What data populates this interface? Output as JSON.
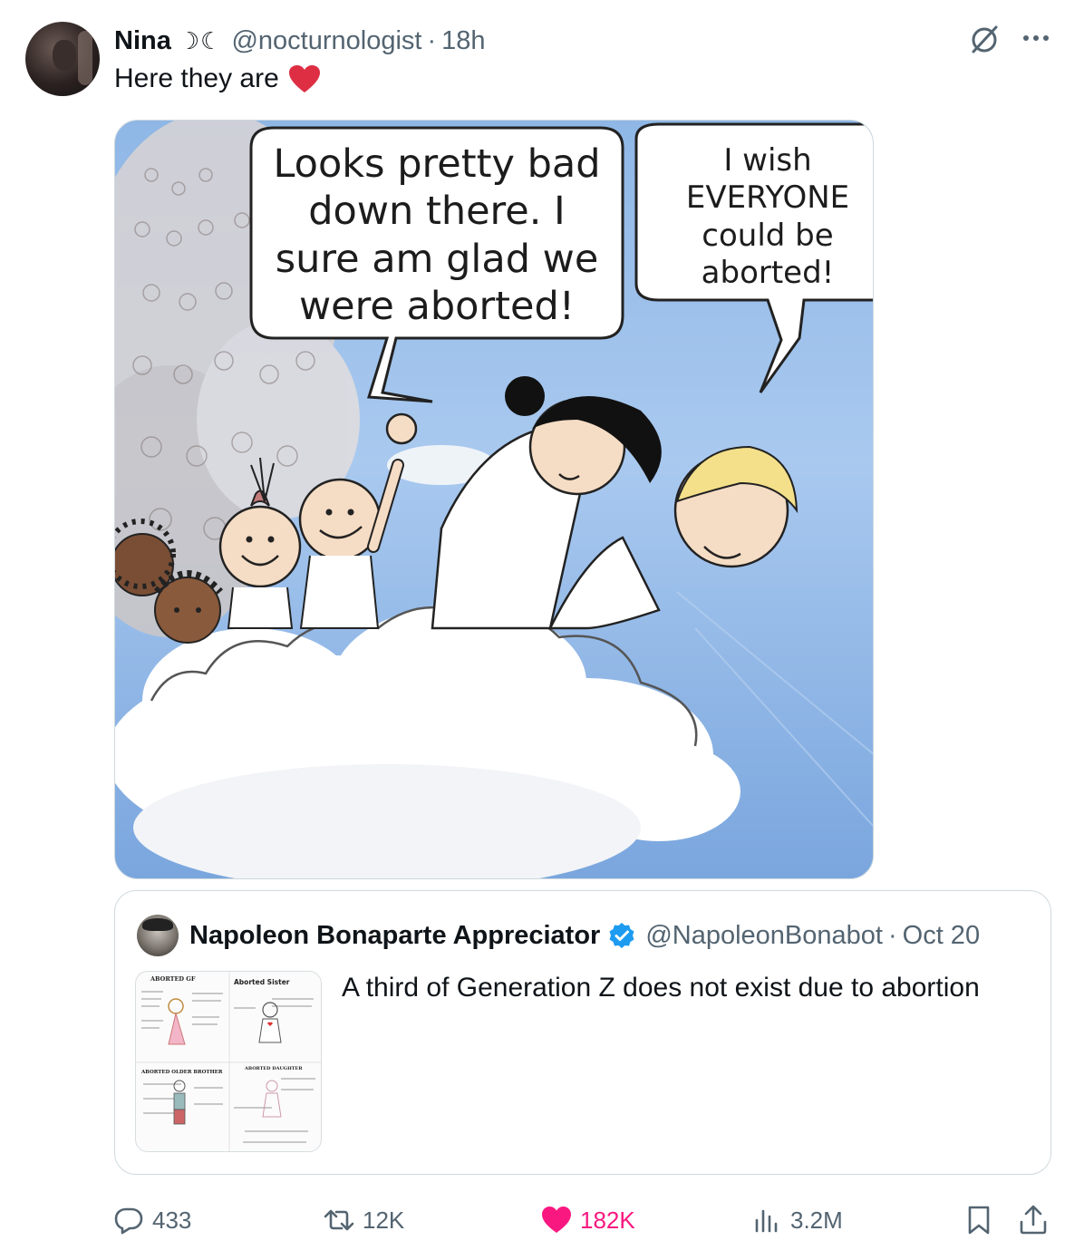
{
  "tweet": {
    "author_name": "Nina",
    "author_moons": "☽☾",
    "author_handle": "@nocturnologist",
    "separator": "·",
    "time": "18h",
    "text": "Here they are",
    "text_emoji": "red-heart"
  },
  "media": {
    "bubble_left": [
      "Looks pretty bad",
      "down there. I",
      "sure am glad we",
      "were aborted!"
    ],
    "bubble_right": [
      "I wish",
      "EVERYONE",
      "could be",
      "aborted!"
    ]
  },
  "quote": {
    "author_name": "Napoleon Bonaparte Appreciator",
    "author_handle": "@NapoleonBonabot",
    "separator": "·",
    "time": "Oct 20",
    "text": "A third of Generation Z does not exist due to abortion",
    "thumbnail_labels": {
      "top_left": "ABORTED GF",
      "top_right": "Aborted Sister",
      "bottom_left": "ABORTED OLDER BROTHER",
      "bottom_right": "ABORTED DAUGHTER"
    }
  },
  "actions": {
    "replies": "433",
    "reposts": "12K",
    "likes": "182K",
    "views": "3.2M"
  },
  "colors": {
    "text_primary": "#0f1419",
    "text_secondary": "#536471",
    "like_pink": "#f91880",
    "verified_blue": "#1d9bf0",
    "border": "#cfd9de"
  },
  "icons": [
    "grok-icon",
    "more-icon",
    "verified-badge-icon",
    "reply-icon",
    "repost-icon",
    "like-icon",
    "views-icon",
    "bookmark-icon",
    "share-icon"
  ]
}
